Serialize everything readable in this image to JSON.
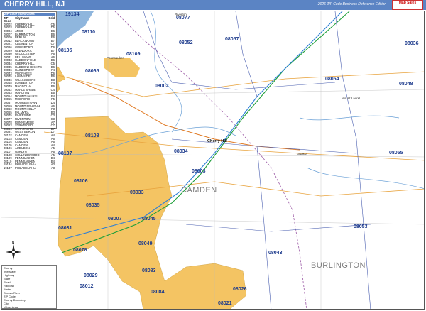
{
  "header": {
    "title": "CHERRY HILL, NJ",
    "edition": "2026 ZIP Code Business Reference Edition",
    "logo": "Map Sales"
  },
  "zip_panel": {
    "title": "ZIP Code Index/Cities",
    "columns": [
      "ZIP Code",
      "City Name",
      "Grid"
    ],
    "rows": [
      [
        "08002",
        "CHERRY HILL",
        "C5"
      ],
      [
        "08003",
        "CHERRY HILL",
        "D5"
      ],
      [
        "08004",
        "ATCO",
        "E6"
      ],
      [
        "08007",
        "BARRINGTON",
        "B6"
      ],
      [
        "08009",
        "BERLIN",
        "E6"
      ],
      [
        "08012",
        "BLACKWOOD",
        "B7"
      ],
      [
        "08021",
        "CLEMENTON",
        "C7"
      ],
      [
        "08026",
        "GIBBSBORO",
        "D6"
      ],
      [
        "08029",
        "GLENDORA",
        "B7"
      ],
      [
        "08030",
        "GLOUCESTER",
        "A6"
      ],
      [
        "08031",
        "BELLMAWR",
        "A6"
      ],
      [
        "08033",
        "HADDONFIELD",
        "B6"
      ],
      [
        "08034",
        "CHERRY HILL",
        "C5"
      ],
      [
        "08035",
        "HADDON HEIGHTS",
        "B6"
      ],
      [
        "08036",
        "HAINESPORT",
        "F4"
      ],
      [
        "08043",
        "VOORHEES",
        "D6"
      ],
      [
        "08045",
        "LAWNSIDE",
        "B6"
      ],
      [
        "08046",
        "WILLINGBORO",
        "E3"
      ],
      [
        "08048",
        "LUMBERTON",
        "F4"
      ],
      [
        "08049",
        "MAGNOLIA",
        "B6"
      ],
      [
        "08052",
        "MAPLE SHADE",
        "C4"
      ],
      [
        "08053",
        "MARLTON",
        "E5"
      ],
      [
        "08054",
        "MOUNT LAUREL",
        "E4"
      ],
      [
        "08055",
        "MEDFORD",
        "F5"
      ],
      [
        "08057",
        "MOORESTOWN",
        "D4"
      ],
      [
        "08059",
        "MOUNT EPHRAIM",
        "A6"
      ],
      [
        "08060",
        "MOUNT HOLLY",
        "F3"
      ],
      [
        "08065",
        "PALMYRA",
        "B3"
      ],
      [
        "08075",
        "RIVERSIDE",
        "C3"
      ],
      [
        "08077",
        "RIVERTON",
        "C3"
      ],
      [
        "08078",
        "RUNNEMEDE",
        "A7"
      ],
      [
        "08083",
        "STRATFORD",
        "C7"
      ],
      [
        "08084",
        "STRATFORD",
        "B7"
      ],
      [
        "08091",
        "WEST BERLIN",
        "D7"
      ],
      [
        "08102",
        "CAMDEN",
        "A4"
      ],
      [
        "08103",
        "CAMDEN",
        "A5"
      ],
      [
        "08104",
        "CAMDEN",
        "A5"
      ],
      [
        "08105",
        "CAMDEN",
        "A4"
      ],
      [
        "08106",
        "AUDUBON",
        "A5"
      ],
      [
        "08107",
        "OAKLYN",
        "A5"
      ],
      [
        "08108",
        "COLLINGSWOOD",
        "A5"
      ],
      [
        "08109",
        "PENNSAUKEN",
        "B4"
      ],
      [
        "08110",
        "PENNSAUKEN",
        "B4"
      ],
      [
        "19134",
        "PHILADELPHIA",
        "A3"
      ],
      [
        "19137",
        "PHILADELPHIA",
        "A3"
      ]
    ]
  },
  "legend": {
    "items": [
      "County",
      "Interstate",
      "Highway",
      "State",
      "Road",
      "Railroad",
      "Water",
      "Stream/River",
      "ZIP Code",
      "County Boundary",
      "City",
      "Urban Area"
    ]
  },
  "compass": {
    "label": "N"
  },
  "zip_labels": [
    "19134",
    "08077",
    "08110",
    "08052",
    "08057",
    "08036",
    "08105",
    "08109",
    "08065",
    "08002",
    "08054",
    "08048",
    "08108",
    "08034",
    "08107",
    "08003",
    "08055",
    "08106",
    "08033",
    "08035",
    "08031",
    "08007",
    "08045",
    "08053",
    "08078",
    "08049",
    "08043",
    "08083",
    "08029",
    "08012",
    "08084",
    "08026",
    "08021"
  ],
  "county_labels": [
    "CAMDEN",
    "BURLINGTON"
  ],
  "place_labels": [
    "Pennsauken",
    "Mount Laurel",
    "Marlton",
    "Cherry Hill",
    "Riverton"
  ]
}
